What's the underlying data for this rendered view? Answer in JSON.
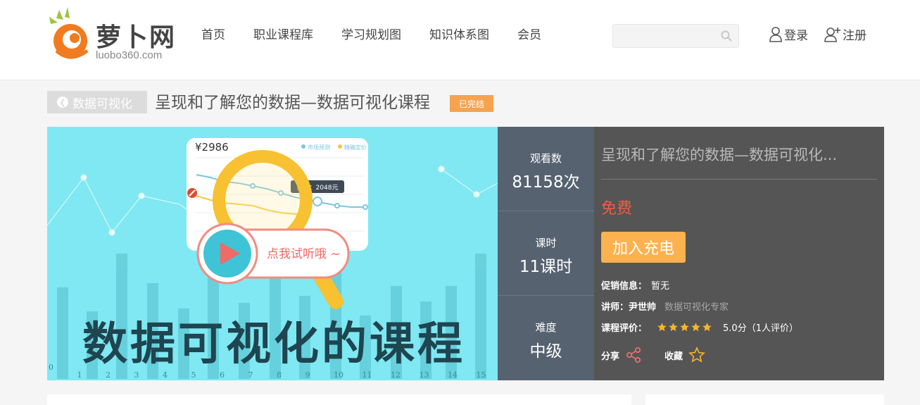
{
  "logo": {
    "text": "萝卜网",
    "domain": "luobo360.com"
  },
  "nav": [
    {
      "label": "首页"
    },
    {
      "label": "职业课程库"
    },
    {
      "label": "学习规划图"
    },
    {
      "label": "知识体系图"
    },
    {
      "label": "会员"
    }
  ],
  "search": {
    "placeholder": ""
  },
  "auth": {
    "login": "登录",
    "register": "注册"
  },
  "breadcrumb": {
    "label": "数据可视化"
  },
  "course": {
    "title": "呈现和了解您的数据—数据可视化课程",
    "status": "已完结"
  },
  "banner": {
    "price_tag": "¥2986",
    "legend_a": "市场预测",
    "legend_b": "精确定价",
    "tooltip": "实点：2048元",
    "play_text": "点我试听哦 ~",
    "headline": "数据可视化的课程",
    "x_ticks": [
      "0",
      "1",
      "2",
      "3",
      "4",
      "5",
      "6",
      "7",
      "8",
      "9",
      "10",
      "11",
      "12",
      "13",
      "14",
      "15"
    ]
  },
  "stats": [
    {
      "label": "观看数",
      "value": "81158次"
    },
    {
      "label": "课时",
      "value": "11课时"
    },
    {
      "label": "难度",
      "value": "中级"
    }
  ],
  "info": {
    "title": "呈现和了解您的数据—数据可视化...",
    "price": "免费",
    "join_label": "加入充电",
    "promo_key": "促销信息：",
    "promo_value": "暂无",
    "teacher_key": "讲师：",
    "teacher_name": "尹世帅",
    "teacher_title": "数据可视化专家",
    "rating_key": "课程评价：",
    "rating_stars": 5,
    "rating_text": "5.0分（1人评价）",
    "share_label": "分享",
    "favorite_label": "收藏"
  },
  "colors": {
    "accent": "#f6a350",
    "button": "#fbb24f",
    "price": "#f15b46",
    "stats_bg": "#566270",
    "info_bg": "#555555",
    "banner_bg": "#7fe8f2",
    "star": "#f7b52c"
  }
}
